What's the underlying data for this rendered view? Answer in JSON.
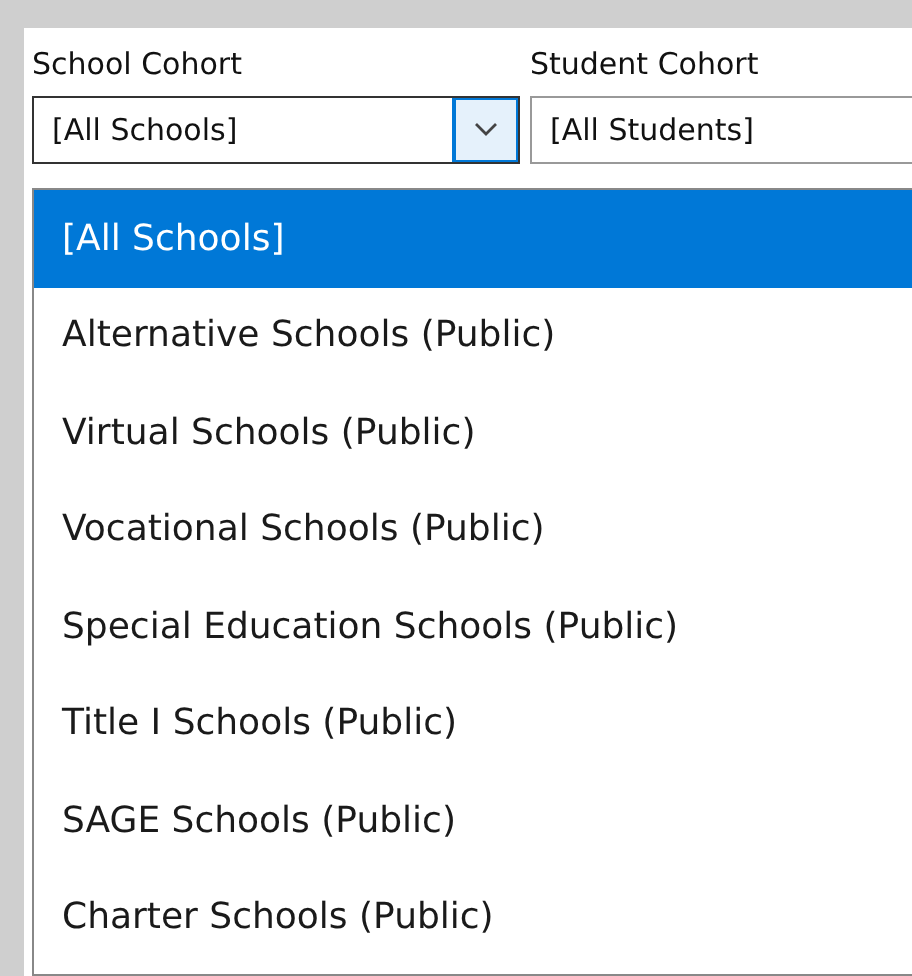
{
  "filters": [
    {
      "label": "School Cohort",
      "value": "[All Schools]",
      "open": true
    },
    {
      "label": "Student Cohort",
      "value": "[All Students]",
      "open": false
    }
  ],
  "dropdown": {
    "options": [
      {
        "label": "[All Schools]",
        "selected": true
      },
      {
        "label": "Alternative Schools (Public)",
        "selected": false
      },
      {
        "label": "Virtual Schools (Public)",
        "selected": false
      },
      {
        "label": "Vocational Schools (Public)",
        "selected": false
      },
      {
        "label": "Special Education Schools (Public)",
        "selected": false
      },
      {
        "label": "Title I Schools (Public)",
        "selected": false
      },
      {
        "label": "SAGE Schools (Public)",
        "selected": false
      },
      {
        "label": "Charter Schools (Public)",
        "selected": false
      }
    ]
  }
}
